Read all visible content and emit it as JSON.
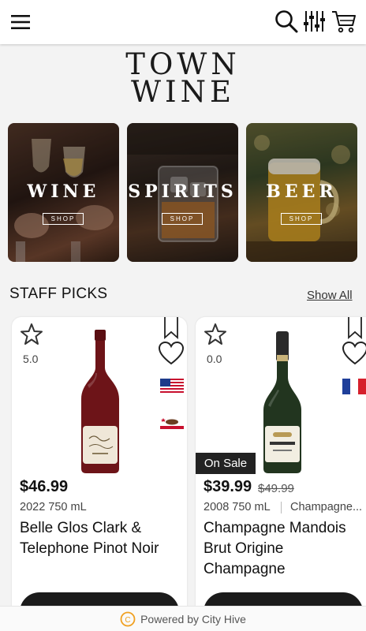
{
  "header": {
    "menu_icon": "hamburger-menu-icon",
    "search_icon": "search-icon",
    "filter_icon": "filter-sliders-icon",
    "cart_icon": "cart-icon"
  },
  "logo": {
    "line1": "TOWN",
    "line2": "WINE"
  },
  "categories": [
    {
      "name": "WINE",
      "button": "SHOP"
    },
    {
      "name": "SPIRITS",
      "button": "SHOP"
    },
    {
      "name": "BEER",
      "button": "SHOP"
    }
  ],
  "staff_picks": {
    "title": "STAFF PICKS",
    "show_all": "Show All",
    "products": [
      {
        "rating": "5.0",
        "price": "$46.99",
        "meta": "2022 750 mL",
        "name": "Belle Glos Clark & Telephone Pinot Noir",
        "flags": [
          "us-flag-icon",
          "california-flag-icon"
        ]
      },
      {
        "badge": "On Sale",
        "rating": "0.0",
        "price": "$39.99",
        "old_price": "$49.99",
        "meta": "2008 750 mL",
        "region": "Champagne...",
        "name": "Champagne Mandois Brut Origine Champagne",
        "flags": [
          "france-flag-icon"
        ]
      }
    ]
  },
  "footer": {
    "text": "Powered by City Hive"
  },
  "colors": {
    "accent": "#1b1b1b",
    "sale_badge": "#222222",
    "footer_logo": "#f0a020"
  }
}
